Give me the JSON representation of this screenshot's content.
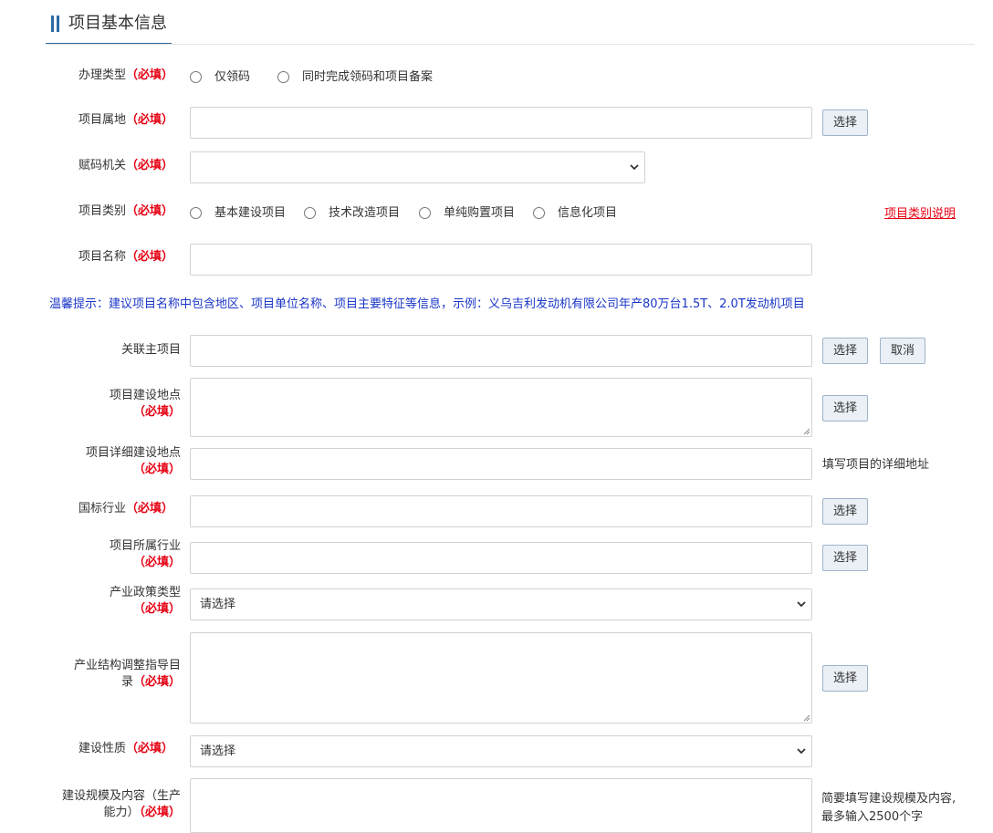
{
  "section": {
    "title": "项目基本信息"
  },
  "required_mark": "（必填）",
  "select_btn": "选择",
  "cancel_btn": "取消",
  "placeholder_select": "请选择",
  "fields": {
    "handle_type": {
      "label": "办理类型",
      "options": [
        "仅领码",
        "同时完成领码和项目备案"
      ]
    },
    "location": {
      "label": "项目属地",
      "value": ""
    },
    "code_authority": {
      "label": "赋码机关",
      "value": ""
    },
    "category": {
      "label": "项目类别",
      "options": [
        "基本建设项目",
        "技术改造项目",
        "单纯购置项目",
        "信息化项目"
      ],
      "link": "项目类别说明"
    },
    "name": {
      "label": "项目名称",
      "value": ""
    },
    "tip": "温馨提示：建议项目名称中包含地区、项目单位名称、项目主要特征等信息，示例：义乌吉利发动机有限公司年产80万台1.5T、2.0T发动机项目",
    "main_project": {
      "label": "关联主项目",
      "value": ""
    },
    "site": {
      "label": "项目建设地点",
      "value": ""
    },
    "site_detail": {
      "label": "项目详细建设地点",
      "value": "",
      "hint": "填写项目的详细地址"
    },
    "national_industry": {
      "label": "国标行业",
      "value": ""
    },
    "project_industry": {
      "label": "项目所属行业",
      "value": ""
    },
    "policy_type": {
      "label": "产业政策类型",
      "value": "请选择"
    },
    "structure_catalog": {
      "label_line1": "产业结构调整指导目",
      "label_line2": "录",
      "value": ""
    },
    "nature": {
      "label": "建设性质",
      "value": "请选择"
    },
    "scale": {
      "label_line1": "建设规模及内容（生产",
      "label_line2": "能力）",
      "value": "",
      "hint": "简要填写建设规模及内容,最多输入2500个字"
    }
  }
}
